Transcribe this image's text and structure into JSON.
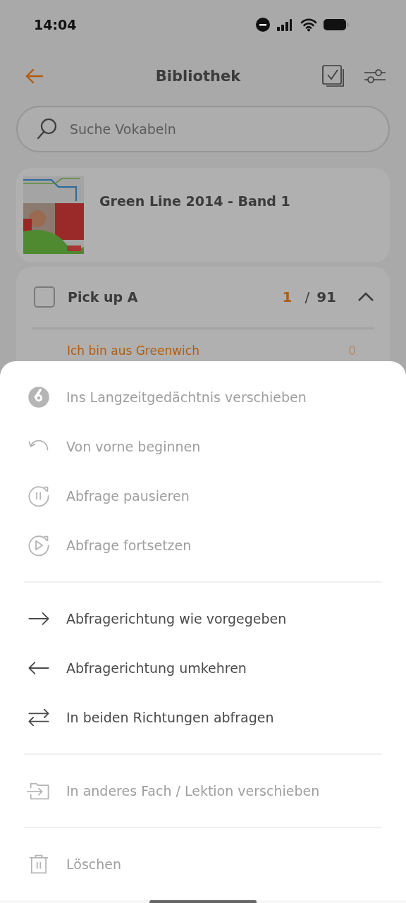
{
  "status_bar": {
    "time": "14:04"
  },
  "header": {
    "title": "Bibliothek"
  },
  "search": {
    "placeholder": "Suche Vokabeln"
  },
  "book": {
    "title": "Green Line 2014 - Band 1"
  },
  "section": {
    "title": "Pick up A",
    "checked": false,
    "expanded": true,
    "done": "1",
    "separator": "/",
    "total": "91",
    "lessons": [
      {
        "title": "Ich bin aus Greenwich",
        "count": "0"
      }
    ]
  },
  "sheet": {
    "groups": [
      {
        "items": [
          {
            "kind": "longterm",
            "label": "Ins Langzeitgedächtnis verschieben",
            "disabled": true
          },
          {
            "kind": "restart",
            "label": "Von vorne beginnen",
            "disabled": true
          },
          {
            "kind": "pause",
            "label": "Abfrage pausieren",
            "disabled": true
          },
          {
            "kind": "resume",
            "label": "Abfrage fortsetzen",
            "disabled": true
          }
        ]
      },
      {
        "items": [
          {
            "kind": "forward",
            "label": "Abfragerichtung wie vorgegeben",
            "disabled": false
          },
          {
            "kind": "backward",
            "label": "Abfragerichtung umkehren",
            "disabled": false
          },
          {
            "kind": "both",
            "label": "In beiden Richtungen abfragen",
            "disabled": false
          }
        ]
      },
      {
        "items": [
          {
            "kind": "move",
            "label": "In anderes Fach / Lektion verschieben",
            "disabled": true
          }
        ]
      },
      {
        "items": [
          {
            "kind": "delete",
            "label": "Löschen",
            "disabled": true
          }
        ]
      }
    ]
  }
}
